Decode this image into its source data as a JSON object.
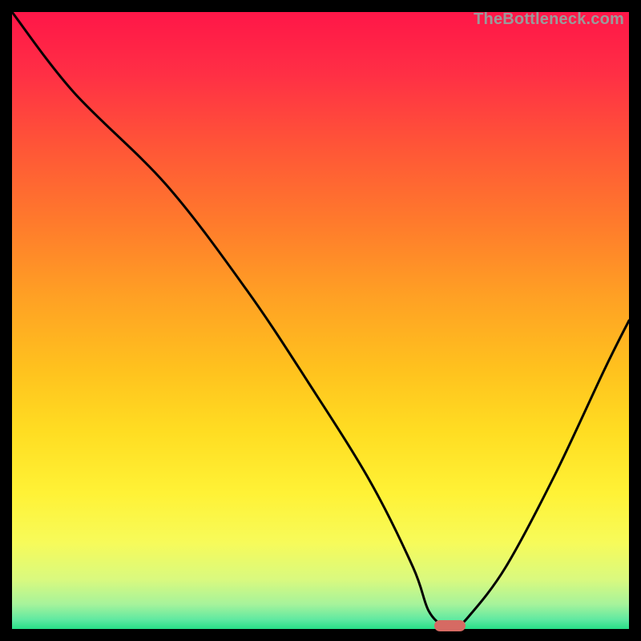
{
  "watermark": "TheBottleneck.com",
  "chart_data": {
    "type": "line",
    "title": "",
    "xlabel": "",
    "ylabel": "",
    "xlim": [
      0,
      100
    ],
    "ylim": [
      0,
      100
    ],
    "series": [
      {
        "name": "bottleneck-curve",
        "x": [
          0,
          10,
          25,
          38,
          48,
          58,
          65,
          67.5,
          70,
          72,
          74,
          80,
          88,
          96,
          100
        ],
        "values": [
          100,
          87,
          72,
          55,
          40,
          24,
          10,
          3,
          0.5,
          0.5,
          2,
          10,
          25,
          42,
          50
        ]
      }
    ],
    "marker": {
      "x": 71,
      "y": 0.5,
      "color": "#d66a63",
      "width_pct": 5.0,
      "height_pct": 1.8
    },
    "line_color": "#000000",
    "line_width": 3,
    "background_gradient": {
      "stops": [
        {
          "offset": 0.0,
          "color": "#ff1648"
        },
        {
          "offset": 0.1,
          "color": "#ff2f45"
        },
        {
          "offset": 0.22,
          "color": "#ff5637"
        },
        {
          "offset": 0.34,
          "color": "#ff7a2c"
        },
        {
          "offset": 0.46,
          "color": "#ffa024"
        },
        {
          "offset": 0.58,
          "color": "#ffc21e"
        },
        {
          "offset": 0.68,
          "color": "#ffdd22"
        },
        {
          "offset": 0.78,
          "color": "#fff236"
        },
        {
          "offset": 0.86,
          "color": "#f7fb5a"
        },
        {
          "offset": 0.92,
          "color": "#d9f97f"
        },
        {
          "offset": 0.96,
          "color": "#a6f39b"
        },
        {
          "offset": 0.985,
          "color": "#5fe9a1"
        },
        {
          "offset": 1.0,
          "color": "#27df86"
        }
      ]
    }
  }
}
